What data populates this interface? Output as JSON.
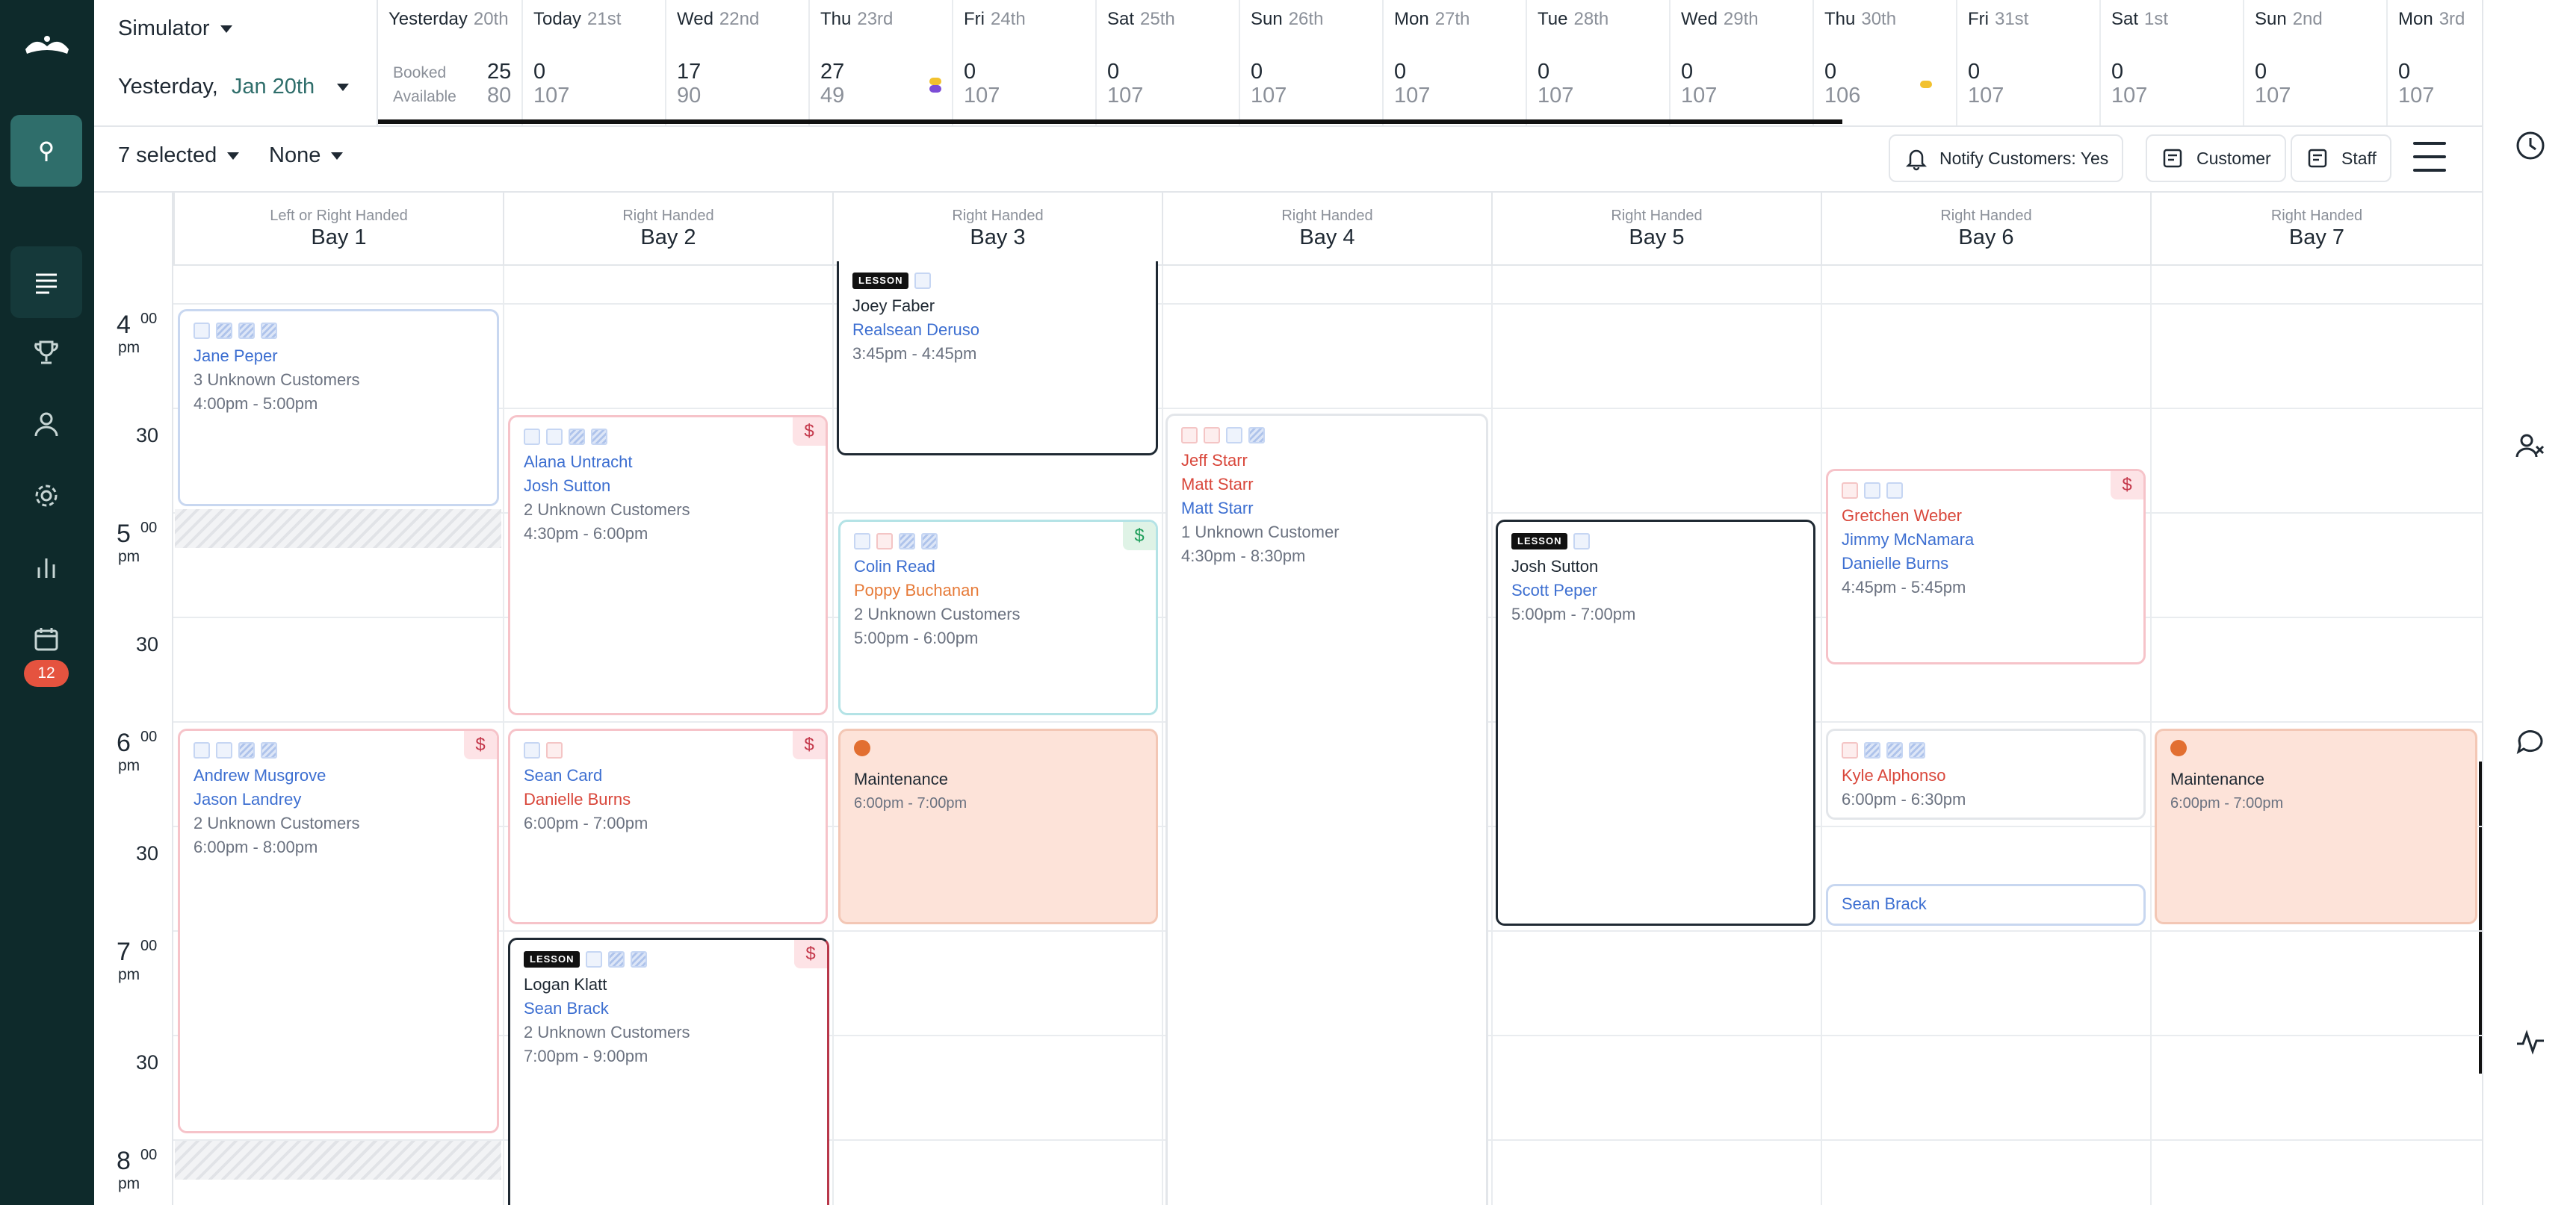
{
  "header": {
    "simulator_label": "Simulator",
    "date_prefix": "Yesterday,",
    "date_value": "Jan 20th",
    "booked_label": "Booked",
    "available_label": "Available"
  },
  "days": [
    {
      "name": "Yesterday",
      "date": "20th",
      "booked": "25",
      "available": "80"
    },
    {
      "name": "Today",
      "date": "21st",
      "booked": "0",
      "available": "107"
    },
    {
      "name": "Wed",
      "date": "22nd",
      "booked": "17",
      "available": "90"
    },
    {
      "name": "Thu",
      "date": "23rd",
      "booked": "27",
      "available": "49"
    },
    {
      "name": "Fri",
      "date": "24th",
      "booked": "0",
      "available": "107"
    },
    {
      "name": "Sat",
      "date": "25th",
      "booked": "0",
      "available": "107"
    },
    {
      "name": "Sun",
      "date": "26th",
      "booked": "0",
      "available": "107"
    },
    {
      "name": "Mon",
      "date": "27th",
      "booked": "0",
      "available": "107"
    },
    {
      "name": "Tue",
      "date": "28th",
      "booked": "0",
      "available": "107"
    },
    {
      "name": "Wed",
      "date": "29th",
      "booked": "0",
      "available": "107"
    },
    {
      "name": "Thu",
      "date": "30th",
      "booked": "0",
      "available": "106"
    },
    {
      "name": "Fri",
      "date": "31st",
      "booked": "0",
      "available": "107"
    },
    {
      "name": "Sat",
      "date": "1st",
      "booked": "0",
      "available": "107"
    },
    {
      "name": "Sun",
      "date": "2nd",
      "booked": "0",
      "available": "107"
    },
    {
      "name": "Mon",
      "date": "3rd",
      "booked": "0",
      "available": "107"
    }
  ],
  "toolbar": {
    "selected": "7 selected",
    "filter": "None",
    "notify": "Notify Customers: Yes",
    "customer": "Customer",
    "staff": "Staff"
  },
  "sidebar": {
    "badge_count": "12"
  },
  "bays": [
    {
      "hand": "Left or Right Handed",
      "name": "Bay 1"
    },
    {
      "hand": "Right Handed",
      "name": "Bay 2"
    },
    {
      "hand": "Right Handed",
      "name": "Bay 3"
    },
    {
      "hand": "Right Handed",
      "name": "Bay 4"
    },
    {
      "hand": "Right Handed",
      "name": "Bay 5"
    },
    {
      "hand": "Right Handed",
      "name": "Bay 6"
    },
    {
      "hand": "Right Handed",
      "name": "Bay 7"
    }
  ],
  "times": [
    {
      "hour": "4",
      "min": "00",
      "ampm": "pm",
      "half": "30"
    },
    {
      "hour": "5",
      "min": "00",
      "ampm": "pm",
      "half": "30"
    },
    {
      "hour": "6",
      "min": "00",
      "ampm": "pm",
      "half": "30"
    },
    {
      "hour": "7",
      "min": "00",
      "ampm": "pm",
      "half": "30"
    },
    {
      "hour": "8",
      "min": "00",
      "ampm": "pm",
      "half": ""
    }
  ],
  "bookings": {
    "b3_joey": {
      "lesson": "LESSON",
      "l1": "Joey Faber",
      "l2": "Realsean Deruso",
      "time": "3:45pm - 4:45pm"
    },
    "b1_jane": {
      "l1": "Jane Peper",
      "l2": "3 Unknown Customers",
      "time": "4:00pm - 5:00pm"
    },
    "b2_alana": {
      "l1": "Alana Untracht",
      "l2": "Josh Sutton",
      "l3": "2 Unknown Customers",
      "time": "4:30pm - 6:00pm"
    },
    "b4_jeff": {
      "l1": "Jeff Starr",
      "l2": "Matt Starr",
      "l3": "Matt Starr",
      "l4": "1 Unknown Customer",
      "time": "4:30pm - 8:30pm"
    },
    "b6_gretchen": {
      "l1": "Gretchen Weber",
      "l2": "Jimmy McNamara",
      "l3": "Danielle Burns",
      "time": "4:45pm - 5:45pm"
    },
    "b3_colin": {
      "l1": "Colin Read",
      "l2": "Poppy Buchanan",
      "l3": "2 Unknown Customers",
      "time": "5:00pm - 6:00pm"
    },
    "b5_josh": {
      "lesson": "LESSON",
      "l1": "Josh Sutton",
      "l2": "Scott Peper",
      "time": "5:00pm - 7:00pm"
    },
    "b1_andrew": {
      "l1": "Andrew Musgrove",
      "l2": "Jason Landrey",
      "l3": "2 Unknown Customers",
      "time": "6:00pm - 8:00pm"
    },
    "b2_sean": {
      "l1": "Sean Card",
      "l2": "Danielle Burns",
      "time": "6:00pm - 7:00pm"
    },
    "b3_maint": {
      "l1": "Maintenance",
      "time": "6:00pm - 7:00pm"
    },
    "b6_kyle": {
      "l1": "Kyle Alphonso",
      "time": "6:00pm - 6:30pm"
    },
    "b7_maint": {
      "l1": "Maintenance",
      "time": "6:00pm - 7:00pm"
    },
    "b6_brack": {
      "l1": "Sean Brack"
    },
    "b2_logan": {
      "lesson": "LESSON",
      "l1": "Logan Klatt",
      "l2": "Sean Brack",
      "l3": "2 Unknown Customers",
      "time": "7:00pm - 9:00pm"
    }
  },
  "price_symbol": "$",
  "colors": {
    "sidebar": "#0e2a2b",
    "accent": "#2f6e6b",
    "badge": "#e5533f",
    "maintenance": "#fde3d9",
    "blue_name": "#3d6fd1",
    "red_name": "#d9473b"
  }
}
